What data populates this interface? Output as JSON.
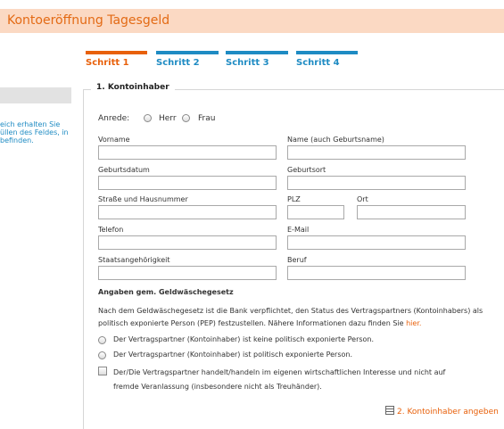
{
  "title": "Kontoeröffnung Tagesgeld",
  "steps": [
    {
      "label": "Schritt 1",
      "color": "#e8600a"
    },
    {
      "label": "Schritt 2",
      "color": "#1e8bc3"
    },
    {
      "label": "Schritt 3",
      "color": "#1e8bc3"
    },
    {
      "label": "Schritt 4",
      "color": "#1e8bc3"
    }
  ],
  "sidebar": {
    "help_text": "eich erhalten Sie\nüllen des Feldes, in\nbefinden."
  },
  "form": {
    "section_title": "1. Kontoinhaber",
    "anrede_label": "Anrede:",
    "anrede_herr": "Herr",
    "anrede_frau": "Frau",
    "fields": {
      "vorname": "Vorname",
      "name": "Name (auch Geburtsname)",
      "geburtsdatum": "Geburtsdatum",
      "geburtsort": "Geburtsort",
      "strasse": "Straße und Hausnummer",
      "plz": "PLZ",
      "ort": "Ort",
      "telefon": "Telefon",
      "email": "E-Mail",
      "staatsangehoerigkeit": "Staatsangehörigkeit",
      "beruf": "Beruf"
    },
    "gwg": {
      "title": "Angaben gem. Geldwäschegesetz",
      "paragraph": "Nach dem Geldwäschegesetz ist die Bank verpflichtet, den Status des Vertragspartners (Kontoinhabers) als politisch exponierte Person (PEP) festzustellen. Nähere Informationen dazu finden Sie ",
      "link": "hier.",
      "option_not_pep": "Der Vertragspartner (Kontoinhaber) ist keine politisch exponierte Person.",
      "option_pep": "Der Vertragspartner (Kontoinhaber) ist politisch exponierte Person.",
      "checkbox_text": "Der/Die Vertragspartner handelt/handeln im eigenen wirtschaftlichen Interesse und nicht auf fremde Veranlassung (insbesondere nicht als Treuhänder)."
    }
  },
  "footer": {
    "next_label": "2. Kontoinhaber angeben"
  }
}
